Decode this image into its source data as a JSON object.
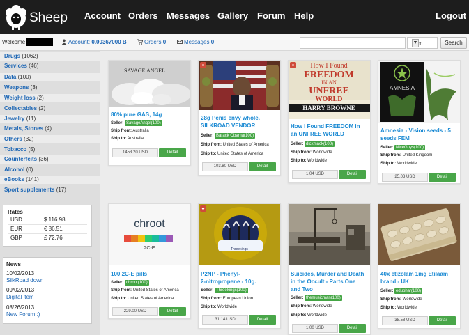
{
  "brand": {
    "name": "Sheep"
  },
  "nav": {
    "account": "Account",
    "orders": "Orders",
    "messages": "Messages",
    "gallery": "Gallery",
    "forum": "Forum",
    "help": "Help",
    "logout": "Logout"
  },
  "status": {
    "welcome": "Welcome",
    "account_label": "Account:",
    "account_value": "0.00367000 B",
    "orders_label": "Orders",
    "orders_value": "0",
    "messages_label": "Messages",
    "messages_value": "0"
  },
  "search": {
    "value": "",
    "select_value": "Item",
    "button": "Search"
  },
  "categories": [
    {
      "name": "Drugs",
      "count": "(1062)"
    },
    {
      "name": "Services",
      "count": "(46)"
    },
    {
      "name": "Data",
      "count": "(100)"
    },
    {
      "name": "Weapons",
      "count": "(3)"
    },
    {
      "name": "Weight loss",
      "count": "(2)"
    },
    {
      "name": "Collectables",
      "count": "(2)"
    },
    {
      "name": "Jewelry",
      "count": "(11)"
    },
    {
      "name": "Metals, Stones",
      "count": "(4)"
    },
    {
      "name": "Others",
      "count": "(32)"
    },
    {
      "name": "Tobacco",
      "count": "(5)"
    },
    {
      "name": "Counterfeits",
      "count": "(36)"
    },
    {
      "name": "Alcohol",
      "count": "(0)"
    },
    {
      "name": "eBooks",
      "count": "(141)"
    },
    {
      "name": "Sport supplements",
      "count": "(17)"
    }
  ],
  "rates": {
    "title": "Rates",
    "rows": [
      {
        "currency": "USD",
        "amount": "$ 116.98"
      },
      {
        "currency": "EUR",
        "amount": "€ 86.51"
      },
      {
        "currency": "GBP",
        "amount": "£ 72.76"
      }
    ]
  },
  "news": {
    "title": "News",
    "items": [
      {
        "date": "10/02/2013",
        "link": "SilkRoad down"
      },
      {
        "date": "09/02/2013",
        "link": "Digital item"
      },
      {
        "date": "08/26/2013",
        "link": "New Forum :)"
      }
    ]
  },
  "labels": {
    "seller": "Seller:",
    "ship_from": "Ship from:",
    "ship_to": "Ship to:",
    "detail": "Detail"
  },
  "products": [
    {
      "title_lines": [
        "80% pure GAS, 14g",
        ""
      ],
      "image_text": "SAVAGE ANGEL",
      "seller": "SavageAngel(100)",
      "ship_from": "Australia",
      "ship_to": "Australia",
      "price": "1453.20 USD",
      "badge": false
    },
    {
      "title_lines": [
        "28g Penis envy whole.",
        "SILKROAD VENDOR"
      ],
      "image_text": "",
      "seller": "Barack Obama(100)",
      "ship_from": "United States of America",
      "ship_to": "United States of America",
      "price": "103.80 USD",
      "badge": true
    },
    {
      "title_lines": [
        "How I Found FREEDOM in",
        "an UNFREE WORLD"
      ],
      "image_text": "How I Found FREEDOM in an UNFREE WORLD HARRY BROWNE",
      "seller": "dickmack(100)",
      "ship_from": "Worldwide",
      "ship_to": "Worldwide",
      "price": "1.04 USD",
      "badge": true
    },
    {
      "title_lines": [
        "Amnesia - Vision seeds - 5",
        "seeds FEM"
      ],
      "image_text": "AMNESIA",
      "seller": "NiceGuys(100)",
      "ship_from": "United Kingdom",
      "ship_to": "Worldwide",
      "price": "25.03 USD",
      "badge": false
    },
    {
      "title_lines": [
        "100 2C-E pills",
        ""
      ],
      "image_text": "chroot",
      "image_subtext": "2C-E",
      "seller": "chroot(100)",
      "ship_from": "United States of America",
      "ship_to": "United States of America",
      "price": "229.00 USD",
      "badge": false
    },
    {
      "title_lines": [
        "P2NP - Phenyl-",
        "2-nitropropene - 10g."
      ],
      "image_text": "Threekings",
      "seller": "Threekings(100)",
      "ship_from": "European Union",
      "ship_to": "Worldwide",
      "price": "31.14 USD",
      "badge": true
    },
    {
      "title_lines": [
        "Suicides, Murder and Death",
        "in the Occult - Parts One",
        "and Two"
      ],
      "image_text": "",
      "seller": "themusicman(100)",
      "ship_from": "Worldwide",
      "ship_to": "Worldwide",
      "price": "1.00 USD",
      "badge": false
    },
    {
      "title_lines": [
        "40x etizolam 1mg Etilaam",
        "brand - UK"
      ],
      "image_text": "",
      "seller": "eduphar(100)",
      "ship_from": "Worldwide",
      "ship_to": "Worldwide",
      "price": "38.58 USD",
      "badge": false
    }
  ]
}
